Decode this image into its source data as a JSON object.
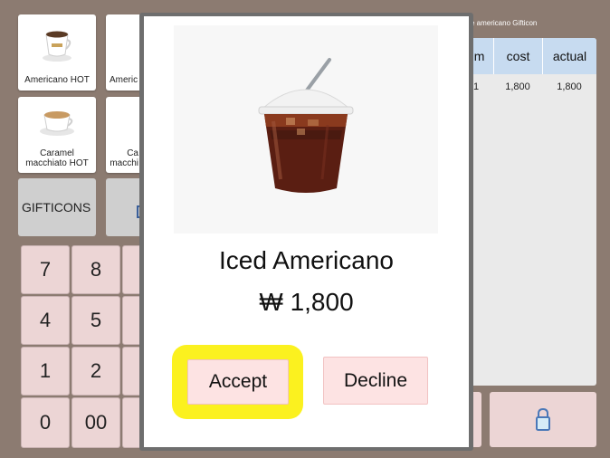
{
  "menu": {
    "items": [
      {
        "label": "Americano HOT",
        "type": "hot"
      },
      {
        "label": "Americ",
        "type": "hot"
      },
      {
        "label": "Caramel macchiato HOT",
        "type": "caramel"
      },
      {
        "label": "Ca macchi",
        "type": "caramel"
      }
    ],
    "gifticons_label": "GIFTICONS"
  },
  "keypad": {
    "keys": [
      "7",
      "8",
      "4",
      "5",
      "1",
      "2",
      "0",
      "00"
    ]
  },
  "order": {
    "caption": "e americano Gifticon",
    "headers": [
      "um",
      "cost",
      "actual"
    ],
    "rows": [
      {
        "num": "1",
        "cost": "1,800",
        "actual": "1,800"
      }
    ]
  },
  "modal": {
    "product_name": "Iced Americano",
    "price": "₩ 1,800",
    "accept_label": "Accept",
    "decline_label": "Decline"
  },
  "icons": {
    "lock": "lock-icon",
    "cup": "coffee-cup-icon",
    "iced": "iced-coffee-icon"
  },
  "colors": {
    "background": "#8c7b71",
    "key": "#ecd5d5",
    "table_header": "#c7dbf0",
    "highlight": "#fbf11f",
    "button": "#fde3e3"
  }
}
